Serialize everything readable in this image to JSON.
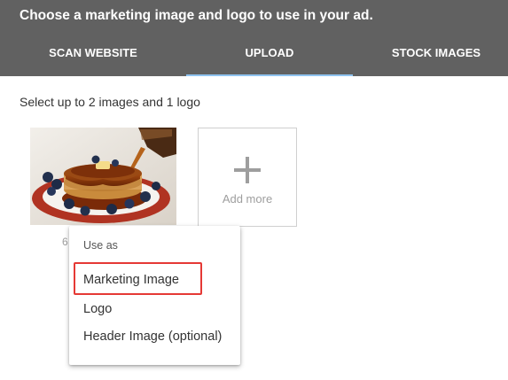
{
  "header": {
    "title": "Choose a marketing image and logo to use in your ad.",
    "background": "#616161"
  },
  "tabs": [
    {
      "label": "SCAN WEBSITE",
      "selected": false
    },
    {
      "label": "UPLOAD",
      "selected": true
    },
    {
      "label": "STOCK IMAGES",
      "selected": false
    }
  ],
  "tab_indicator_color": "#8fc3f0",
  "instructions": "Select up to 2 images and 1 logo",
  "uploaded_image": {
    "subject": "pancakes with blueberries and syrup",
    "caption_partial": "6"
  },
  "add_more": {
    "icon": "plus-icon",
    "label": "Add more"
  },
  "menu": {
    "header": "Use as",
    "items": [
      {
        "label": "Marketing Image",
        "highlighted": true
      },
      {
        "label": "Logo",
        "highlighted": false
      },
      {
        "label": "Header Image (optional)",
        "highlighted": false
      }
    ]
  },
  "highlight_color": "#e53935"
}
